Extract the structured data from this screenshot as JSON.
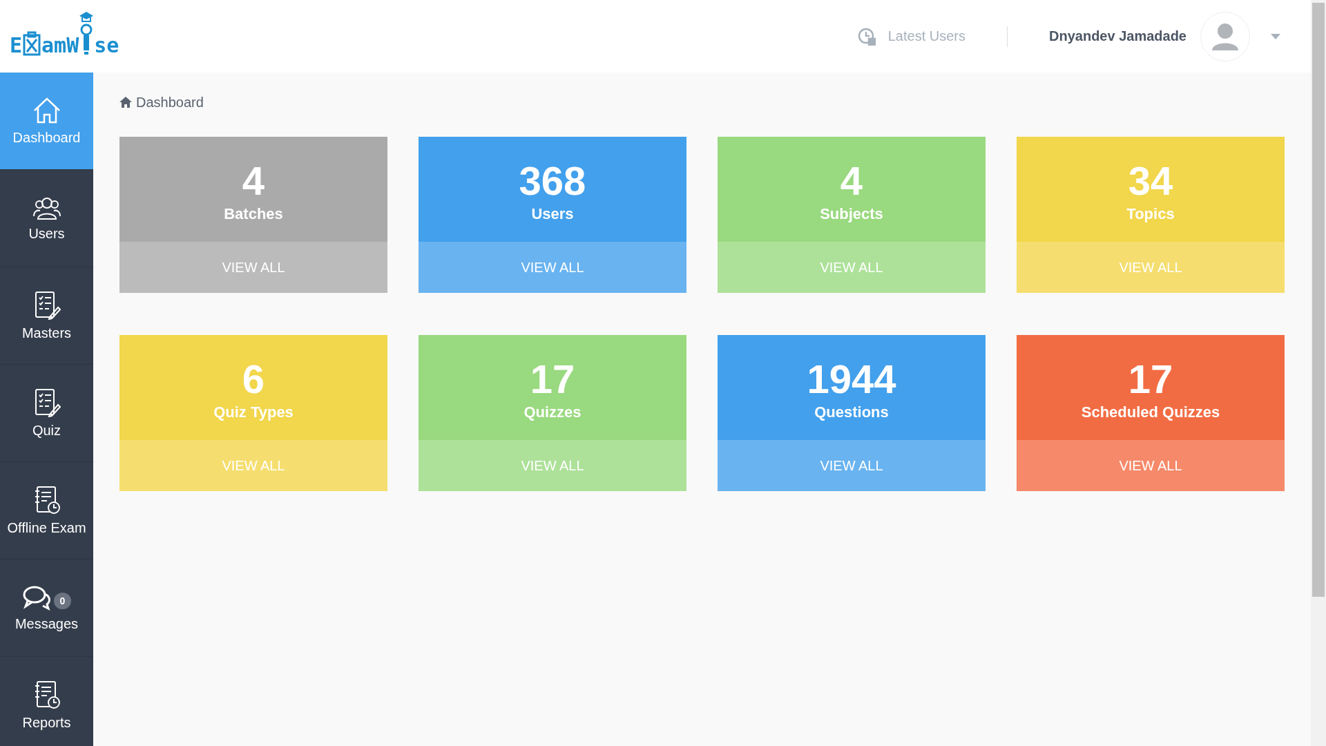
{
  "header": {
    "logo_parts": [
      "E",
      "amW",
      "se"
    ],
    "latest_users": "Latest Users",
    "user_name": "Dnyandev Jamadade"
  },
  "sidebar": {
    "items": [
      {
        "label": "Dashboard",
        "kind": "home",
        "selected": true
      },
      {
        "label": "Users",
        "kind": "users",
        "selected": false
      },
      {
        "label": "Masters",
        "kind": "checklist",
        "selected": false
      },
      {
        "label": "Quiz",
        "kind": "checklist",
        "selected": false
      },
      {
        "label": "Offline Exam",
        "kind": "clockdoc",
        "selected": false
      },
      {
        "label": "Messages",
        "kind": "chat",
        "selected": false,
        "badge": "0"
      },
      {
        "label": "Reports",
        "kind": "clockdoc",
        "selected": false
      }
    ]
  },
  "breadcrumb": "Dashboard",
  "cards": [
    {
      "count": "4",
      "label": "Batches",
      "link": "VIEW ALL",
      "color": "#aaaaaa"
    },
    {
      "count": "368",
      "label": "Users",
      "link": "VIEW ALL",
      "color": "#43a0ec"
    },
    {
      "count": "4",
      "label": "Subjects",
      "link": "VIEW ALL",
      "color": "#99d97f"
    },
    {
      "count": "34",
      "label": "Topics",
      "link": "VIEW ALL",
      "color": "#f2d64b"
    },
    {
      "count": "6",
      "label": "Quiz Types",
      "link": "VIEW ALL",
      "color": "#f2d64b"
    },
    {
      "count": "17",
      "label": "Quizzes",
      "link": "VIEW ALL",
      "color": "#99d97f"
    },
    {
      "count": "1944",
      "label": "Questions",
      "link": "VIEW ALL",
      "color": "#43a0ec"
    },
    {
      "count": "17",
      "label": "Scheduled Quizzes",
      "link": "VIEW ALL",
      "color": "#f26c43"
    }
  ]
}
